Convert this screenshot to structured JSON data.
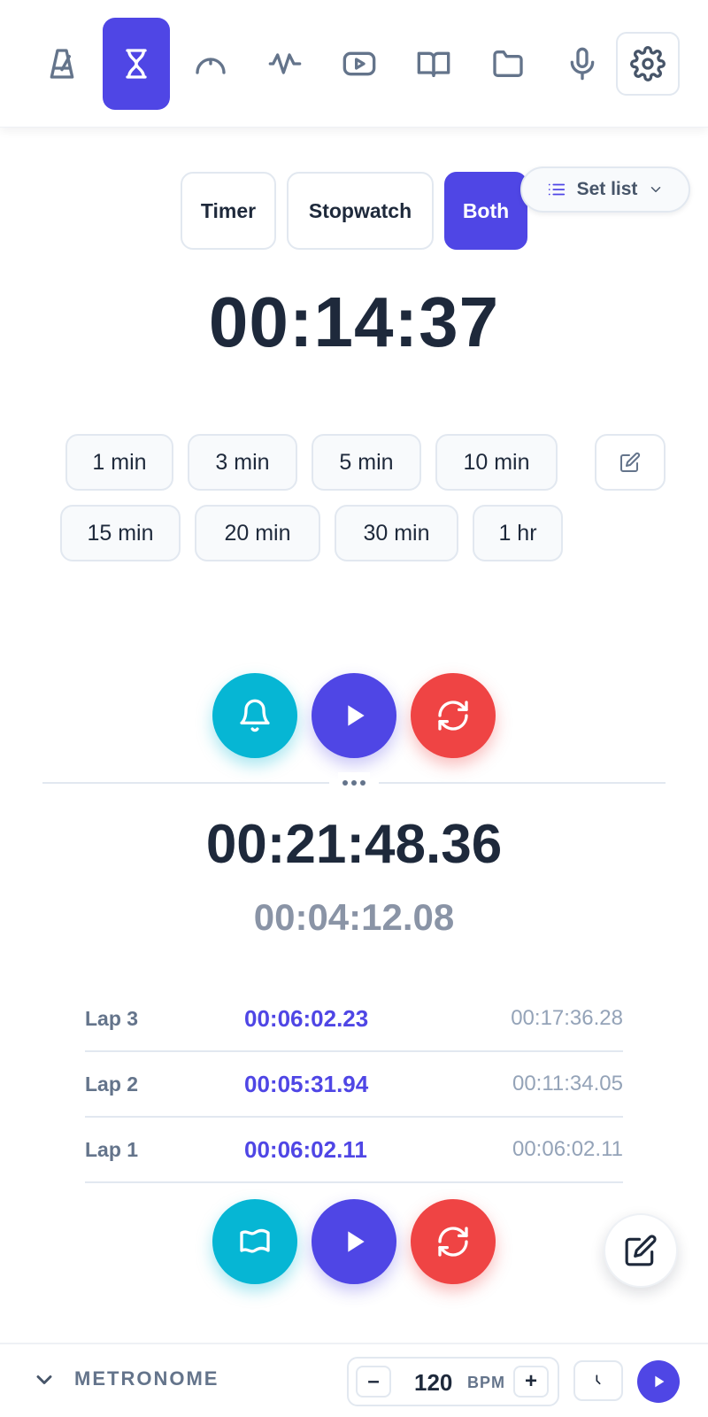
{
  "nav": {
    "items": [
      {
        "name": "metronome",
        "icon": "metronome-icon"
      },
      {
        "name": "timer",
        "icon": "hourglass-icon",
        "active": true
      },
      {
        "name": "tuner",
        "icon": "gauge-icon"
      },
      {
        "name": "drone",
        "icon": "wave-icon"
      },
      {
        "name": "video",
        "icon": "youtube-icon"
      },
      {
        "name": "book",
        "icon": "book-icon"
      },
      {
        "name": "folder",
        "icon": "folder-icon"
      },
      {
        "name": "recorder",
        "icon": "microphone-icon"
      },
      {
        "name": "settings",
        "icon": "gear-icon"
      }
    ]
  },
  "mode": {
    "timer_label": "Timer",
    "stopwatch_label": "Stopwatch",
    "both_label": "Both",
    "selected": "Both"
  },
  "setlist": {
    "label": "Set list"
  },
  "timer": {
    "display": "00:14:37",
    "presets_row1": [
      "1 min",
      "3 min",
      "5 min",
      "10 min"
    ],
    "presets_row2": [
      "15 min",
      "20 min",
      "30 min",
      "1 hr"
    ]
  },
  "stopwatch": {
    "main": "00:21:48.36",
    "current_lap": "00:04:12.08",
    "laps": [
      {
        "name": "Lap 3",
        "split": "00:06:02.23",
        "total": "00:17:36.28"
      },
      {
        "name": "Lap 2",
        "split": "00:05:31.94",
        "total": "00:11:34.05"
      },
      {
        "name": "Lap 1",
        "split": "00:06:02.11",
        "total": "00:06:02.11"
      }
    ]
  },
  "metronome_bar": {
    "label": "METRONOME",
    "bpm": "120",
    "bpm_unit": "BPM",
    "minus": "–",
    "plus": "+"
  },
  "colors": {
    "accent": "#4f46e5",
    "cyan": "#06b6d4",
    "red": "#ef4444",
    "text": "#1e293b",
    "muted": "#94a3b8"
  }
}
